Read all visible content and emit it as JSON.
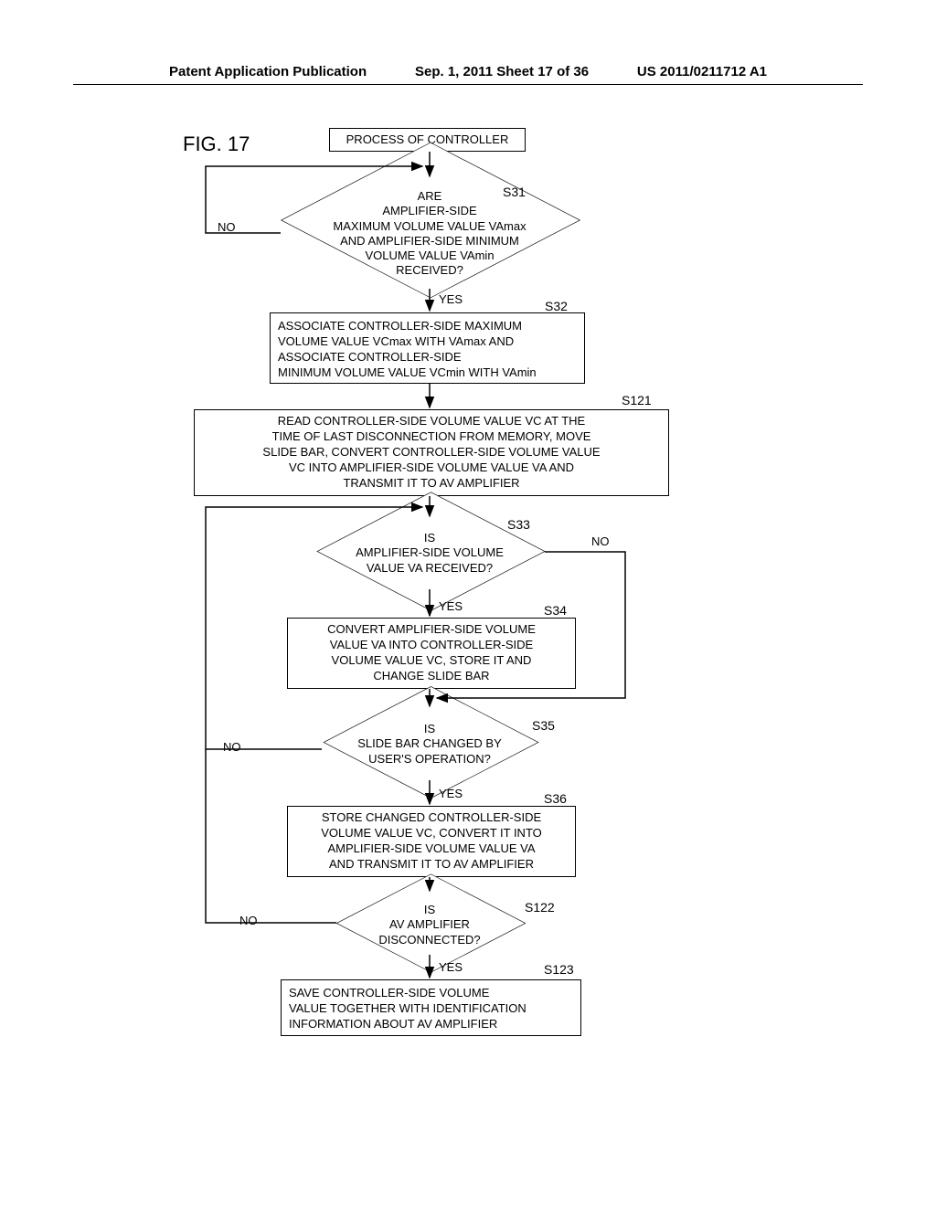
{
  "header": {
    "left": "Patent Application Publication",
    "center": "Sep. 1, 2011  Sheet 17 of 36",
    "right": "US 2011/0211712 A1"
  },
  "figure_label": "FIG.  17",
  "start_box": "PROCESS OF CONTROLLER",
  "s31": {
    "label": "S31",
    "text": "ARE\nAMPLIFIER-SIDE\nMAXIMUM VOLUME VALUE VAmax\nAND AMPLIFIER-SIDE MINIMUM\nVOLUME VALUE VAmin\nRECEIVED?",
    "yes": "YES",
    "no": "NO"
  },
  "s32": {
    "label": "S32",
    "text": "ASSOCIATE CONTROLLER-SIDE MAXIMUM\nVOLUME VALUE VCmax WITH VAmax AND\nASSOCIATE CONTROLLER-SIDE\nMINIMUM VOLUME VALUE VCmin WITH VAmin"
  },
  "s121": {
    "label": "S121",
    "text": "READ CONTROLLER-SIDE VOLUME VALUE VC AT THE\nTIME OF LAST DISCONNECTION FROM MEMORY, MOVE\nSLIDE BAR, CONVERT CONTROLLER-SIDE VOLUME VALUE\nVC INTO AMPLIFIER-SIDE VOLUME VALUE VA AND\nTRANSMIT IT TO AV AMPLIFIER"
  },
  "s33": {
    "label": "S33",
    "text": "IS\nAMPLIFIER-SIDE VOLUME\nVALUE VA RECEIVED?",
    "yes": "YES",
    "no": "NO"
  },
  "s34": {
    "label": "S34",
    "text": "CONVERT AMPLIFIER-SIDE VOLUME\nVALUE VA INTO CONTROLLER-SIDE\nVOLUME VALUE VC, STORE IT AND\nCHANGE SLIDE BAR"
  },
  "s35": {
    "label": "S35",
    "text": "IS\nSLIDE BAR CHANGED BY\nUSER'S OPERATION?",
    "yes": "YES",
    "no": "NO"
  },
  "s36": {
    "label": "S36",
    "text": "STORE CHANGED CONTROLLER-SIDE\nVOLUME VALUE VC, CONVERT IT INTO\nAMPLIFIER-SIDE VOLUME VALUE VA\nAND TRANSMIT IT TO AV AMPLIFIER"
  },
  "s122": {
    "label": "S122",
    "text": "IS\nAV AMPLIFIER\nDISCONNECTED?",
    "yes": "YES",
    "no": "NO"
  },
  "s123": {
    "label": "S123",
    "text": "SAVE CONTROLLER-SIDE VOLUME\nVALUE TOGETHER WITH IDENTIFICATION\nINFORMATION ABOUT AV AMPLIFIER"
  }
}
